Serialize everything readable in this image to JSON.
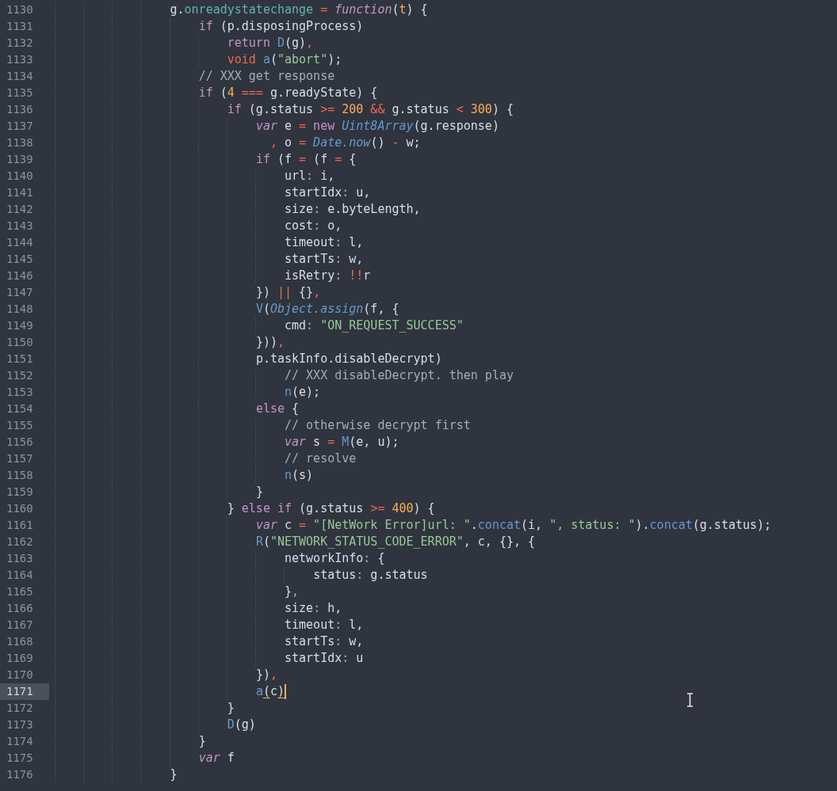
{
  "editor": {
    "lines": [
      {
        "number": "1130",
        "current": false,
        "tokens": [
          {
            "kind": "t",
            "text": "                g."
          },
          {
            "kind": "p",
            "text": "onreadystatechange"
          },
          {
            "kind": "o",
            "text": " = "
          },
          {
            "kind": "ki",
            "text": "function"
          },
          {
            "kind": "t",
            "text": "("
          },
          {
            "kind": "a",
            "text": "t"
          },
          {
            "kind": "t",
            "text": ") {"
          }
        ]
      },
      {
        "number": "1131",
        "current": false,
        "tokens": [
          {
            "kind": "k",
            "text": "                    if"
          },
          {
            "kind": "t",
            "text": " (p.disposingProcess)"
          }
        ]
      },
      {
        "number": "1132",
        "current": false,
        "tokens": [
          {
            "kind": "k",
            "text": "                        return"
          },
          {
            "kind": "f",
            "text": " D"
          },
          {
            "kind": "t",
            "text": "(g)"
          },
          {
            "kind": "o",
            "text": ","
          }
        ]
      },
      {
        "number": "1133",
        "current": false,
        "tokens": [
          {
            "kind": "o",
            "text": "                        void"
          },
          {
            "kind": "f",
            "text": " a"
          },
          {
            "kind": "t",
            "text": "("
          },
          {
            "kind": "s",
            "text": "\"abort\""
          },
          {
            "kind": "t",
            "text": ");"
          }
        ]
      },
      {
        "number": "1134",
        "current": false,
        "tokens": [
          {
            "kind": "c",
            "text": "                    // XXX get response"
          }
        ]
      },
      {
        "number": "1135",
        "current": false,
        "tokens": [
          {
            "kind": "k",
            "text": "                    if"
          },
          {
            "kind": "t",
            "text": " ("
          },
          {
            "kind": "n",
            "text": "4"
          },
          {
            "kind": "o",
            "text": " === "
          },
          {
            "kind": "t",
            "text": "g.readyState) {"
          }
        ]
      },
      {
        "number": "1136",
        "current": false,
        "tokens": [
          {
            "kind": "k",
            "text": "                        if"
          },
          {
            "kind": "t",
            "text": " (g.status "
          },
          {
            "kind": "o",
            "text": ">="
          },
          {
            "kind": "n",
            "text": " 200"
          },
          {
            "kind": "o",
            "text": " &&"
          },
          {
            "kind": "t",
            "text": " g.status "
          },
          {
            "kind": "o",
            "text": "<"
          },
          {
            "kind": "n",
            "text": " 300"
          },
          {
            "kind": "t",
            "text": ") {"
          }
        ]
      },
      {
        "number": "1137",
        "current": false,
        "tokens": [
          {
            "kind": "ki",
            "text": "                            var"
          },
          {
            "kind": "t",
            "text": " e "
          },
          {
            "kind": "o",
            "text": "="
          },
          {
            "kind": "k",
            "text": " new"
          },
          {
            "kind": "fi",
            "text": " Uint8Array"
          },
          {
            "kind": "t",
            "text": "(g.response)"
          }
        ]
      },
      {
        "number": "1138",
        "current": false,
        "tokens": [
          {
            "kind": "o",
            "text": "                              ,"
          },
          {
            "kind": "t",
            "text": " o "
          },
          {
            "kind": "o",
            "text": "="
          },
          {
            "kind": "fi",
            "text": " Date.now"
          },
          {
            "kind": "t",
            "text": "() "
          },
          {
            "kind": "o",
            "text": "-"
          },
          {
            "kind": "t",
            "text": " w;"
          }
        ]
      },
      {
        "number": "1139",
        "current": false,
        "tokens": [
          {
            "kind": "k",
            "text": "                            if"
          },
          {
            "kind": "t",
            "text": " (f "
          },
          {
            "kind": "o",
            "text": "="
          },
          {
            "kind": "t",
            "text": " (f "
          },
          {
            "kind": "o",
            "text": "="
          },
          {
            "kind": "t",
            "text": " {"
          }
        ]
      },
      {
        "number": "1140",
        "current": false,
        "tokens": [
          {
            "kind": "t",
            "text": "                                url"
          },
          {
            "kind": "d",
            "text": ":"
          },
          {
            "kind": "t",
            "text": " i,"
          }
        ]
      },
      {
        "number": "1141",
        "current": false,
        "tokens": [
          {
            "kind": "t",
            "text": "                                startIdx"
          },
          {
            "kind": "d",
            "text": ":"
          },
          {
            "kind": "t",
            "text": " u,"
          }
        ]
      },
      {
        "number": "1142",
        "current": false,
        "tokens": [
          {
            "kind": "t",
            "text": "                                size"
          },
          {
            "kind": "d",
            "text": ":"
          },
          {
            "kind": "t",
            "text": " e.byteLength,"
          }
        ]
      },
      {
        "number": "1143",
        "current": false,
        "tokens": [
          {
            "kind": "t",
            "text": "                                cost"
          },
          {
            "kind": "d",
            "text": ":"
          },
          {
            "kind": "t",
            "text": " o,"
          }
        ]
      },
      {
        "number": "1144",
        "current": false,
        "tokens": [
          {
            "kind": "t",
            "text": "                                timeout"
          },
          {
            "kind": "d",
            "text": ":"
          },
          {
            "kind": "t",
            "text": " l,"
          }
        ]
      },
      {
        "number": "1145",
        "current": false,
        "tokens": [
          {
            "kind": "t",
            "text": "                                startTs"
          },
          {
            "kind": "d",
            "text": ":"
          },
          {
            "kind": "t",
            "text": " w,"
          }
        ]
      },
      {
        "number": "1146",
        "current": false,
        "tokens": [
          {
            "kind": "t",
            "text": "                                isRetry"
          },
          {
            "kind": "d",
            "text": ":"
          },
          {
            "kind": "o",
            "text": " !!"
          },
          {
            "kind": "t",
            "text": "r"
          }
        ]
      },
      {
        "number": "1147",
        "current": false,
        "tokens": [
          {
            "kind": "t",
            "text": "                            }) "
          },
          {
            "kind": "o",
            "text": "||"
          },
          {
            "kind": "t",
            "text": " {}"
          },
          {
            "kind": "o",
            "text": ","
          }
        ]
      },
      {
        "number": "1148",
        "current": false,
        "tokens": [
          {
            "kind": "f",
            "text": "                            V"
          },
          {
            "kind": "t",
            "text": "("
          },
          {
            "kind": "fi",
            "text": "Object.assign"
          },
          {
            "kind": "t",
            "text": "(f, {"
          }
        ]
      },
      {
        "number": "1149",
        "current": false,
        "tokens": [
          {
            "kind": "t",
            "text": "                                cmd"
          },
          {
            "kind": "d",
            "text": ":"
          },
          {
            "kind": "s",
            "text": " \"ON_REQUEST_SUCCESS\""
          }
        ]
      },
      {
        "number": "1150",
        "current": false,
        "tokens": [
          {
            "kind": "t",
            "text": "                            }))"
          },
          {
            "kind": "o",
            "text": ","
          }
        ]
      },
      {
        "number": "1151",
        "current": false,
        "tokens": [
          {
            "kind": "t",
            "text": "                            p.taskInfo.disableDecrypt)"
          }
        ]
      },
      {
        "number": "1152",
        "current": false,
        "tokens": [
          {
            "kind": "c",
            "text": "                                // XXX disableDecrypt. then play"
          }
        ]
      },
      {
        "number": "1153",
        "current": false,
        "tokens": [
          {
            "kind": "f",
            "text": "                                n"
          },
          {
            "kind": "t",
            "text": "(e);"
          }
        ]
      },
      {
        "number": "1154",
        "current": false,
        "tokens": [
          {
            "kind": "k",
            "text": "                            else"
          },
          {
            "kind": "t",
            "text": " {"
          }
        ]
      },
      {
        "number": "1155",
        "current": false,
        "tokens": [
          {
            "kind": "c",
            "text": "                                // otherwise decrypt first"
          }
        ]
      },
      {
        "number": "1156",
        "current": false,
        "tokens": [
          {
            "kind": "ki",
            "text": "                                var"
          },
          {
            "kind": "t",
            "text": " s "
          },
          {
            "kind": "o",
            "text": "="
          },
          {
            "kind": "f",
            "text": " M"
          },
          {
            "kind": "t",
            "text": "(e, u);"
          }
        ]
      },
      {
        "number": "1157",
        "current": false,
        "tokens": [
          {
            "kind": "c",
            "text": "                                // resolve"
          }
        ]
      },
      {
        "number": "1158",
        "current": false,
        "tokens": [
          {
            "kind": "f",
            "text": "                                n"
          },
          {
            "kind": "t",
            "text": "(s)"
          }
        ]
      },
      {
        "number": "1159",
        "current": false,
        "tokens": [
          {
            "kind": "t",
            "text": "                            }"
          }
        ]
      },
      {
        "number": "1160",
        "current": false,
        "tokens": [
          {
            "kind": "t",
            "text": "                        } "
          },
          {
            "kind": "k",
            "text": "else if"
          },
          {
            "kind": "t",
            "text": " (g.status "
          },
          {
            "kind": "o",
            "text": ">="
          },
          {
            "kind": "n",
            "text": " 400"
          },
          {
            "kind": "t",
            "text": ") {"
          }
        ]
      },
      {
        "number": "1161",
        "current": false,
        "tokens": [
          {
            "kind": "ki",
            "text": "                            var"
          },
          {
            "kind": "t",
            "text": " c "
          },
          {
            "kind": "o",
            "text": "="
          },
          {
            "kind": "s",
            "text": " \"[NetWork Error]url: \""
          },
          {
            "kind": "t",
            "text": "."
          },
          {
            "kind": "f",
            "text": "concat"
          },
          {
            "kind": "t",
            "text": "(i, "
          },
          {
            "kind": "s",
            "text": "\", status: \""
          },
          {
            "kind": "t",
            "text": ")."
          },
          {
            "kind": "f",
            "text": "concat"
          },
          {
            "kind": "t",
            "text": "(g.status);"
          }
        ]
      },
      {
        "number": "1162",
        "current": false,
        "tokens": [
          {
            "kind": "f",
            "text": "                            R"
          },
          {
            "kind": "t",
            "text": "("
          },
          {
            "kind": "s",
            "text": "\"NETWORK_STATUS_CODE_ERROR\""
          },
          {
            "kind": "t",
            "text": ", c, {}, {"
          }
        ]
      },
      {
        "number": "1163",
        "current": false,
        "tokens": [
          {
            "kind": "t",
            "text": "                                networkInfo"
          },
          {
            "kind": "d",
            "text": ":"
          },
          {
            "kind": "t",
            "text": " {"
          }
        ]
      },
      {
        "number": "1164",
        "current": false,
        "tokens": [
          {
            "kind": "t",
            "text": "                                    status"
          },
          {
            "kind": "d",
            "text": ":"
          },
          {
            "kind": "t",
            "text": " g.status"
          }
        ]
      },
      {
        "number": "1165",
        "current": false,
        "tokens": [
          {
            "kind": "t",
            "text": "                                }"
          },
          {
            "kind": "d",
            "text": ","
          }
        ]
      },
      {
        "number": "1166",
        "current": false,
        "tokens": [
          {
            "kind": "t",
            "text": "                                size"
          },
          {
            "kind": "d",
            "text": ":"
          },
          {
            "kind": "t",
            "text": " h,"
          }
        ]
      },
      {
        "number": "1167",
        "current": false,
        "tokens": [
          {
            "kind": "t",
            "text": "                                timeout"
          },
          {
            "kind": "d",
            "text": ":"
          },
          {
            "kind": "t",
            "text": " l,"
          }
        ]
      },
      {
        "number": "1168",
        "current": false,
        "tokens": [
          {
            "kind": "t",
            "text": "                                startTs"
          },
          {
            "kind": "d",
            "text": ":"
          },
          {
            "kind": "t",
            "text": " w,"
          }
        ]
      },
      {
        "number": "1169",
        "current": false,
        "tokens": [
          {
            "kind": "t",
            "text": "                                startIdx"
          },
          {
            "kind": "d",
            "text": ":"
          },
          {
            "kind": "t",
            "text": " u"
          }
        ]
      },
      {
        "number": "1170",
        "current": false,
        "tokens": [
          {
            "kind": "t",
            "text": "                            })"
          },
          {
            "kind": "o",
            "text": ","
          }
        ]
      },
      {
        "number": "1171",
        "current": true,
        "tokens": [
          {
            "kind": "f",
            "text": "                            a"
          },
          {
            "kind": "m",
            "text": "("
          },
          {
            "kind": "t",
            "text": "c"
          },
          {
            "kind": "m",
            "text": ")"
          }
        ]
      },
      {
        "number": "1172",
        "current": false,
        "tokens": [
          {
            "kind": "t",
            "text": "                        }"
          }
        ]
      },
      {
        "number": "1173",
        "current": false,
        "tokens": [
          {
            "kind": "f",
            "text": "                        D"
          },
          {
            "kind": "t",
            "text": "(g)"
          }
        ]
      },
      {
        "number": "1174",
        "current": false,
        "tokens": [
          {
            "kind": "t",
            "text": "                    }"
          }
        ]
      },
      {
        "number": "1175",
        "current": false,
        "tokens": [
          {
            "kind": "ki",
            "text": "                    var"
          },
          {
            "kind": "t",
            "text": " f"
          }
        ]
      },
      {
        "number": "1176",
        "current": false,
        "tokens": [
          {
            "kind": "t",
            "text": "                }"
          }
        ]
      }
    ]
  }
}
